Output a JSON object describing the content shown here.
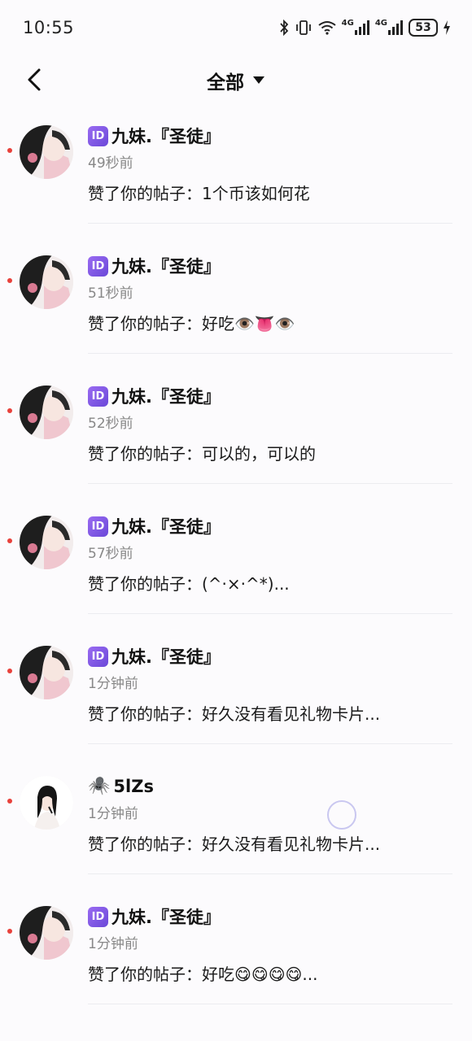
{
  "status_bar": {
    "time": "10:55",
    "icons": [
      "bluetooth-icon",
      "vibrate-icon",
      "wifi-icon",
      "signal-4g-icon",
      "signal-4g-icon"
    ],
    "network_label_1": "4G",
    "network_label_2": "4G",
    "battery": "53"
  },
  "header": {
    "title": "全部",
    "back_icon": "chevron-left-icon",
    "dropdown_icon": "caret-down-icon"
  },
  "notifications": [
    {
      "badge": "ID",
      "name": "九妹.『圣徒』",
      "time": "49秒前",
      "message": "赞了你的帖子：1个币该如何花",
      "unread": true
    },
    {
      "badge": "ID",
      "name": "九妹.『圣徒』",
      "time": "51秒前",
      "message": "赞了你的帖子：好吃👁️👅👁️",
      "unread": true
    },
    {
      "badge": "ID",
      "name": "九妹.『圣徒』",
      "time": "52秒前",
      "message": "赞了你的帖子：可以的，可以的",
      "unread": true
    },
    {
      "badge": "ID",
      "name": "九妹.『圣徒』",
      "time": "57秒前",
      "message": "赞了你的帖子：(^·×·^*)...",
      "unread": true
    },
    {
      "badge": "ID",
      "name": "九妹.『圣徒』",
      "time": "1分钟前",
      "message": "赞了你的帖子：好久没有看见礼物卡片...",
      "unread": true
    },
    {
      "badge": "🕷️",
      "name": "5lZs",
      "time": "1分钟前",
      "message": "赞了你的帖子：好久没有看见礼物卡片...",
      "unread": true
    },
    {
      "badge": "ID",
      "name": "九妹.『圣徒』",
      "time": "1分钟前",
      "message": "赞了你的帖子：好吃😋😋😋😋...",
      "unread": true
    }
  ]
}
